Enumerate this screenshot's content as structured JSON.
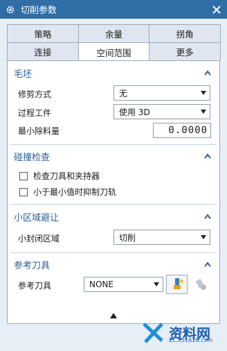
{
  "window": {
    "title": "切削参数",
    "gear_icon": "gear-icon",
    "close_icon": "close-icon"
  },
  "tabs": {
    "row1": [
      {
        "label": "策略"
      },
      {
        "label": "余量"
      },
      {
        "label": "拐角"
      }
    ],
    "row2": [
      {
        "label": "连接",
        "active": false
      },
      {
        "label": "空间范围",
        "active": true
      },
      {
        "label": "更多",
        "active": false
      }
    ]
  },
  "blank": {
    "header": "毛坯",
    "trim_method": {
      "label": "修剪方式",
      "value": "无"
    },
    "process_workpiece": {
      "label": "过程工件",
      "value": "使用 3D"
    },
    "min_removal": {
      "label": "最小除料量",
      "value": "0.0000"
    }
  },
  "collision": {
    "header": "碰撞检查",
    "check_tool_holder": {
      "label": "检查刀具和夹持器",
      "checked": false
    },
    "suppress_toolpath": {
      "label": "小于最小值时抑制刀轨",
      "checked": false
    }
  },
  "small_area": {
    "header": "小区域避让",
    "closed_area": {
      "label": "小封闭区域",
      "value": "切削"
    }
  },
  "ref_tool": {
    "header": "参考刀具",
    "tool": {
      "label": "参考刀具",
      "value": "NONE"
    },
    "new_tool_icon": "new-tool-icon",
    "edit_tool_icon": "edit-tool-icon"
  },
  "watermark": {
    "text": "资料网",
    "url": "ZL.X51616.com"
  },
  "colors": {
    "titlebar": "#2f6ea6",
    "section_header": "#2a5f9a",
    "dialog_bg": "#e6eef6"
  }
}
